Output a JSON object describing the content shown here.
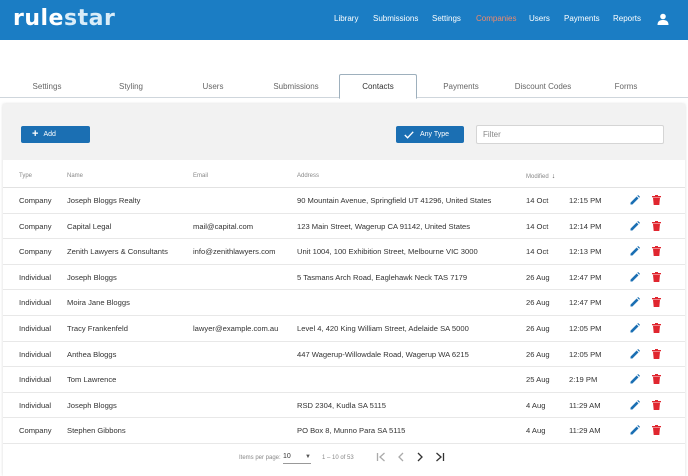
{
  "app": {
    "logo_rule": "rule",
    "logo_star": "star"
  },
  "nav": {
    "items": [
      {
        "label": "Library",
        "active": false
      },
      {
        "label": "Submissions",
        "active": false
      },
      {
        "label": "Settings",
        "active": false
      },
      {
        "label": "Companies",
        "active": true
      },
      {
        "label": "Users",
        "active": false
      },
      {
        "label": "Payments",
        "active": false
      },
      {
        "label": "Reports",
        "active": false
      }
    ],
    "user_icon": "user-icon"
  },
  "tabs": [
    {
      "label": "Settings",
      "active": false
    },
    {
      "label": "Styling",
      "active": false
    },
    {
      "label": "Users",
      "active": false
    },
    {
      "label": "Submissions",
      "active": false
    },
    {
      "label": "Contacts",
      "active": true
    },
    {
      "label": "Payments",
      "active": false
    },
    {
      "label": "Discount Codes",
      "active": false
    },
    {
      "label": "Forms",
      "active": false
    }
  ],
  "toolbar": {
    "add_label": "Add",
    "type_label": "Any Type",
    "filter_placeholder": "Filter"
  },
  "table": {
    "headers": {
      "type": "Type",
      "name": "Name",
      "email": "Email",
      "address": "Address",
      "modified": "Modified"
    },
    "sort_icon": "arrow-down-icon",
    "rows": [
      {
        "type": "Company",
        "name": "Joseph Bloggs Realty",
        "email": "",
        "address": "90 Mountain Avenue, Springfield UT 41296, United States",
        "date": "14 Oct",
        "time": "12:15 PM"
      },
      {
        "type": "Company",
        "name": "Capital Legal",
        "email": "mail@capital.com",
        "address": "123 Main Street, Wagerup CA 91142, United States",
        "date": "14 Oct",
        "time": "12:14 PM"
      },
      {
        "type": "Company",
        "name": "Zenith Lawyers & Consultants",
        "email": "info@zenithlawyers.com",
        "address": "Unit 1004, 100 Exhibition Street, Melbourne VIC 3000",
        "date": "14 Oct",
        "time": "12:13 PM"
      },
      {
        "type": "Individual",
        "name": "Joseph Bloggs",
        "email": "",
        "address": "5 Tasmans Arch Road, Eaglehawk Neck TAS 7179",
        "date": "26 Aug",
        "time": "12:47 PM"
      },
      {
        "type": "Individual",
        "name": "Moira Jane Bloggs",
        "email": "",
        "address": "",
        "date": "26 Aug",
        "time": "12:47 PM"
      },
      {
        "type": "Individual",
        "name": "Tracy Frankenfeld",
        "email": "lawyer@example.com.au",
        "address": "Level 4, 420 King William Street, Adelaide SA 5000",
        "date": "26 Aug",
        "time": "12:05 PM"
      },
      {
        "type": "Individual",
        "name": "Anthea Bloggs",
        "email": "",
        "address": "447 Wagerup-Willowdale Road, Wagerup WA 6215",
        "date": "26 Aug",
        "time": "12:05 PM"
      },
      {
        "type": "Individual",
        "name": "Tom Lawrence",
        "email": "",
        "address": "",
        "date": "25 Aug",
        "time": "2:19 PM"
      },
      {
        "type": "Individual",
        "name": "Joseph Bloggs",
        "email": "",
        "address": "RSD 2304, Kudla SA 5115",
        "date": "4 Aug",
        "time": "11:29 AM"
      },
      {
        "type": "Company",
        "name": "Stephen Gibbons",
        "email": "",
        "address": "PO Box 8, Munno Para SA 5115",
        "date": "4 Aug",
        "time": "11:29 AM"
      }
    ]
  },
  "pagination": {
    "items_per_page_label": "Items per page:",
    "items_per_page_value": "10",
    "range_label": "1 – 10 of 53"
  },
  "colors": {
    "header_bg": "#1b7dc4",
    "accent_active_nav": "#f08a6c",
    "primary_button": "#1b6fb3",
    "edit_icon": "#1b6fb3",
    "delete_icon": "#e0262f"
  }
}
